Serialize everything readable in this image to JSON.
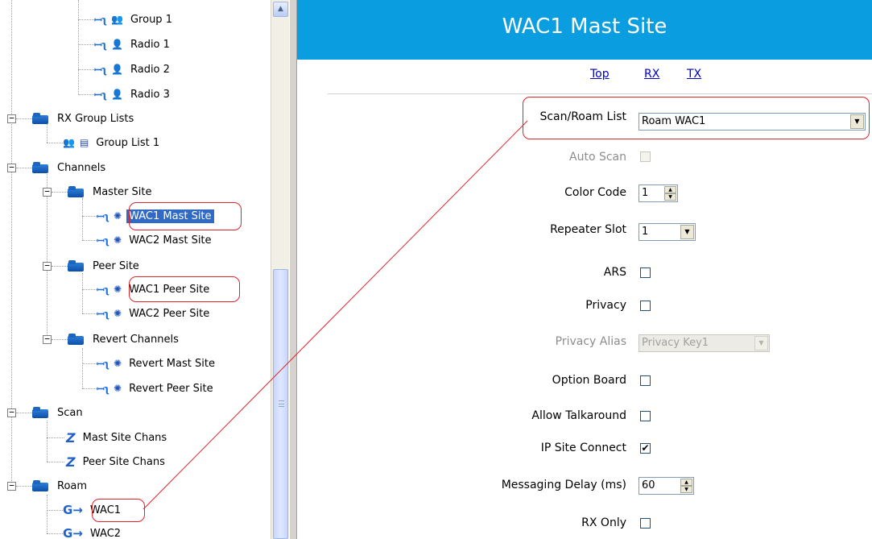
{
  "tree": {
    "group_1": "Group 1",
    "radio_1": "Radio 1",
    "radio_2": "Radio 2",
    "radio_3": "Radio 3",
    "rx_group_lists": "RX Group Lists",
    "group_list_1": "Group List 1",
    "channels": "Channels",
    "master_site": "Master Site",
    "wac1_mast_site": "WAC1 Mast Site",
    "wac2_mast_site": "WAC2 Mast Site",
    "peer_site": "Peer Site",
    "wac1_peer_site": "WAC1 Peer Site",
    "wac2_peer_site": "WAC2 Peer Site",
    "revert_channels": "Revert Channels",
    "revert_mast_site": "Revert Mast Site",
    "revert_peer_site": "Revert Peer Site",
    "scan": "Scan",
    "mast_site_chans": "Mast Site Chans",
    "peer_site_chans": "Peer Site Chans",
    "roam": "Roam",
    "roam_wac1": "WAC1",
    "roam_wac2": "WAC2",
    "expander_symbol": "−",
    "icons": {
      "wave": "ꟷʅ",
      "group": "👥",
      "person": "👤",
      "radio": "✺",
      "scan": "Z",
      "roam": "G→",
      "list": "▤"
    }
  },
  "header": {
    "title": "WAC1 Mast Site",
    "color": "#0a9de0"
  },
  "nav": {
    "top": "Top",
    "rx": "RX",
    "tx": "TX"
  },
  "form": {
    "scan_roam_list": {
      "label": "Scan/Roam List",
      "value": "Roam WAC1"
    },
    "auto_scan": {
      "label": "Auto Scan",
      "checked": false,
      "disabled": true
    },
    "color_code": {
      "label": "Color Code",
      "value": "1"
    },
    "repeater_slot": {
      "label": "Repeater Slot",
      "value": "1"
    },
    "ars": {
      "label": "ARS",
      "checked": false
    },
    "privacy": {
      "label": "Privacy",
      "checked": false
    },
    "privacy_alias": {
      "label": "Privacy Alias",
      "value": "Privacy Key1",
      "disabled": true
    },
    "option_board": {
      "label": "Option Board",
      "checked": false
    },
    "allow_talkaround": {
      "label": "Allow Talkaround",
      "checked": false
    },
    "ip_site_connect": {
      "label": "IP Site Connect",
      "checked": true,
      "mark": "✔"
    },
    "messaging_delay": {
      "label": "Messaging Delay (ms)",
      "value": "60"
    },
    "rx_only": {
      "label": "RX Only",
      "checked": false
    }
  },
  "symbols": {
    "dropdown_arrow": "▼",
    "spin_up": "▲",
    "spin_down": "▼",
    "scroll_up": "▲"
  },
  "annotation_color": "#e0252b"
}
